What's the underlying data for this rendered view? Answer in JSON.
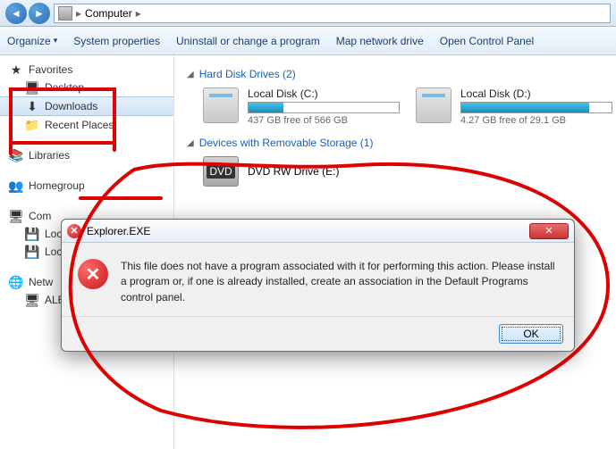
{
  "breadcrumb": {
    "root_icon": "computer",
    "sep": "▸",
    "current": "Computer",
    "sep2": "▸"
  },
  "toolbar": {
    "organize": "Organize",
    "sysprops": "System properties",
    "uninstall": "Uninstall or change a program",
    "mapdrive": "Map network drive",
    "opencp": "Open Control Panel"
  },
  "sidebar": {
    "favorites": {
      "label": "Favorites",
      "items": [
        {
          "label": "Desktop"
        },
        {
          "label": "Downloads"
        },
        {
          "label": "Recent Places"
        }
      ]
    },
    "libraries": {
      "label": "Libraries"
    },
    "homegroup": {
      "label": "Homegroup"
    },
    "computer": {
      "label": "Com",
      "items": [
        {
          "label": "Loc"
        },
        {
          "label": "Loc"
        }
      ]
    },
    "network": {
      "label": "Netw",
      "items": [
        {
          "label": "ALE"
        }
      ]
    }
  },
  "sections": {
    "hdd": {
      "label": "Hard Disk Drives (2)"
    },
    "removable": {
      "label": "Devices with Removable Storage (1)"
    }
  },
  "drives": [
    {
      "name": "Local Disk (C:)",
      "free": "437 GB free of 566 GB",
      "fill_pct": 23
    },
    {
      "name": "Local Disk (D:)",
      "free": "4.27 GB free of 29.1 GB",
      "fill_pct": 85
    }
  ],
  "dvd": {
    "name": "DVD RW Drive (E:)",
    "badge": "DVD"
  },
  "dialog": {
    "title": "Explorer.EXE",
    "message": "This file does not have a program associated with it for performing this action. Please install a program or, if one is already installed, create an association in the Default Programs control panel.",
    "ok": "OK"
  }
}
